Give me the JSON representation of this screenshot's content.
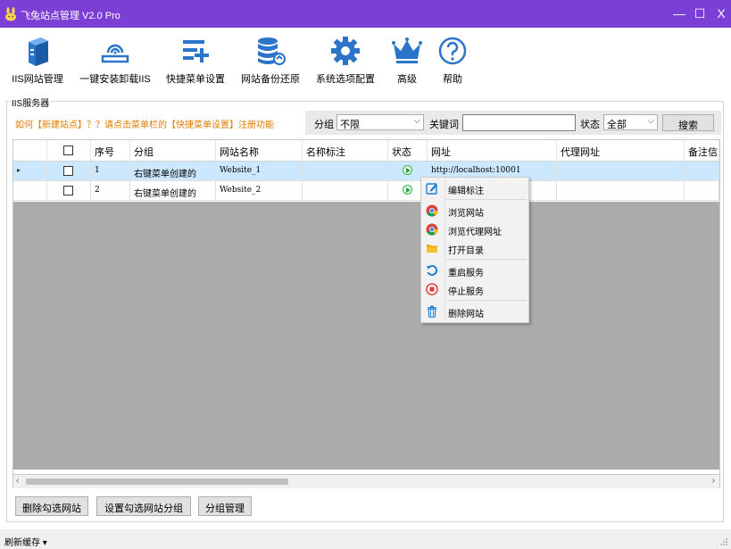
{
  "app": {
    "title": "飞兔站点管理 V2.0 Pro"
  },
  "window_controls": {
    "minimize": "—",
    "maximize": "☐",
    "close": "X"
  },
  "toolbar": [
    {
      "label": "IIS网站管理",
      "icon": "server-icon"
    },
    {
      "label": "一键安装卸载IIS",
      "icon": "install-icon"
    },
    {
      "label": "快捷菜单设置",
      "icon": "menu-add-icon"
    },
    {
      "label": "网站备份还原",
      "icon": "database-icon"
    },
    {
      "label": "系统选项配置",
      "icon": "gear-icon"
    },
    {
      "label": "高级",
      "icon": "crown-icon"
    },
    {
      "label": "帮助",
      "icon": "help-icon"
    }
  ],
  "group": {
    "title": "IIS服务器"
  },
  "hint": "如何【新建站点】？？请点击菜单栏的【快捷菜单设置】注册功能",
  "filter": {
    "group_label": "分组",
    "group_value": "不限",
    "keyword_label": "关键词",
    "keyword_value": "",
    "status_label": "状态",
    "status_value": "全部",
    "search_button": "搜索"
  },
  "table": {
    "columns": [
      "序号",
      "分组",
      "网站名称",
      "名称标注",
      "状态",
      "网址",
      "代理网址",
      "备注信息"
    ],
    "rows": [
      {
        "no": "1",
        "group": "右键菜单创建的",
        "name": "Website_1",
        "note": "",
        "url": "http://localhost:10001",
        "proxy": "",
        "remark": "",
        "selected": true
      },
      {
        "no": "2",
        "group": "右键菜单创建的",
        "name": "Website_2",
        "note": "",
        "url": "",
        "proxy": "",
        "remark": "",
        "selected": false
      }
    ]
  },
  "context_menu": {
    "items": [
      {
        "label": "编辑标注",
        "icon": "edit-icon"
      },
      {
        "label": "浏览网站",
        "icon": "chrome-icon"
      },
      {
        "label": "浏览代理网址",
        "icon": "chrome-icon"
      },
      {
        "label": "打开目录",
        "icon": "folder-icon"
      },
      {
        "label": "重启服务",
        "icon": "restart-icon"
      },
      {
        "label": "停止服务",
        "icon": "stop-icon"
      },
      {
        "label": "删除网站",
        "icon": "trash-icon"
      }
    ]
  },
  "buttons": {
    "delete_checked": "删除勾选网站",
    "set_group": "设置勾选网站分组",
    "group_manage": "分组管理"
  },
  "status": {
    "text": "刷新缓存 ▾"
  },
  "colors": {
    "titlebar": "#7b3fd6",
    "accent": "#1f7fd0",
    "selected_row": "#cce8ff",
    "hint": "#e07a00"
  }
}
